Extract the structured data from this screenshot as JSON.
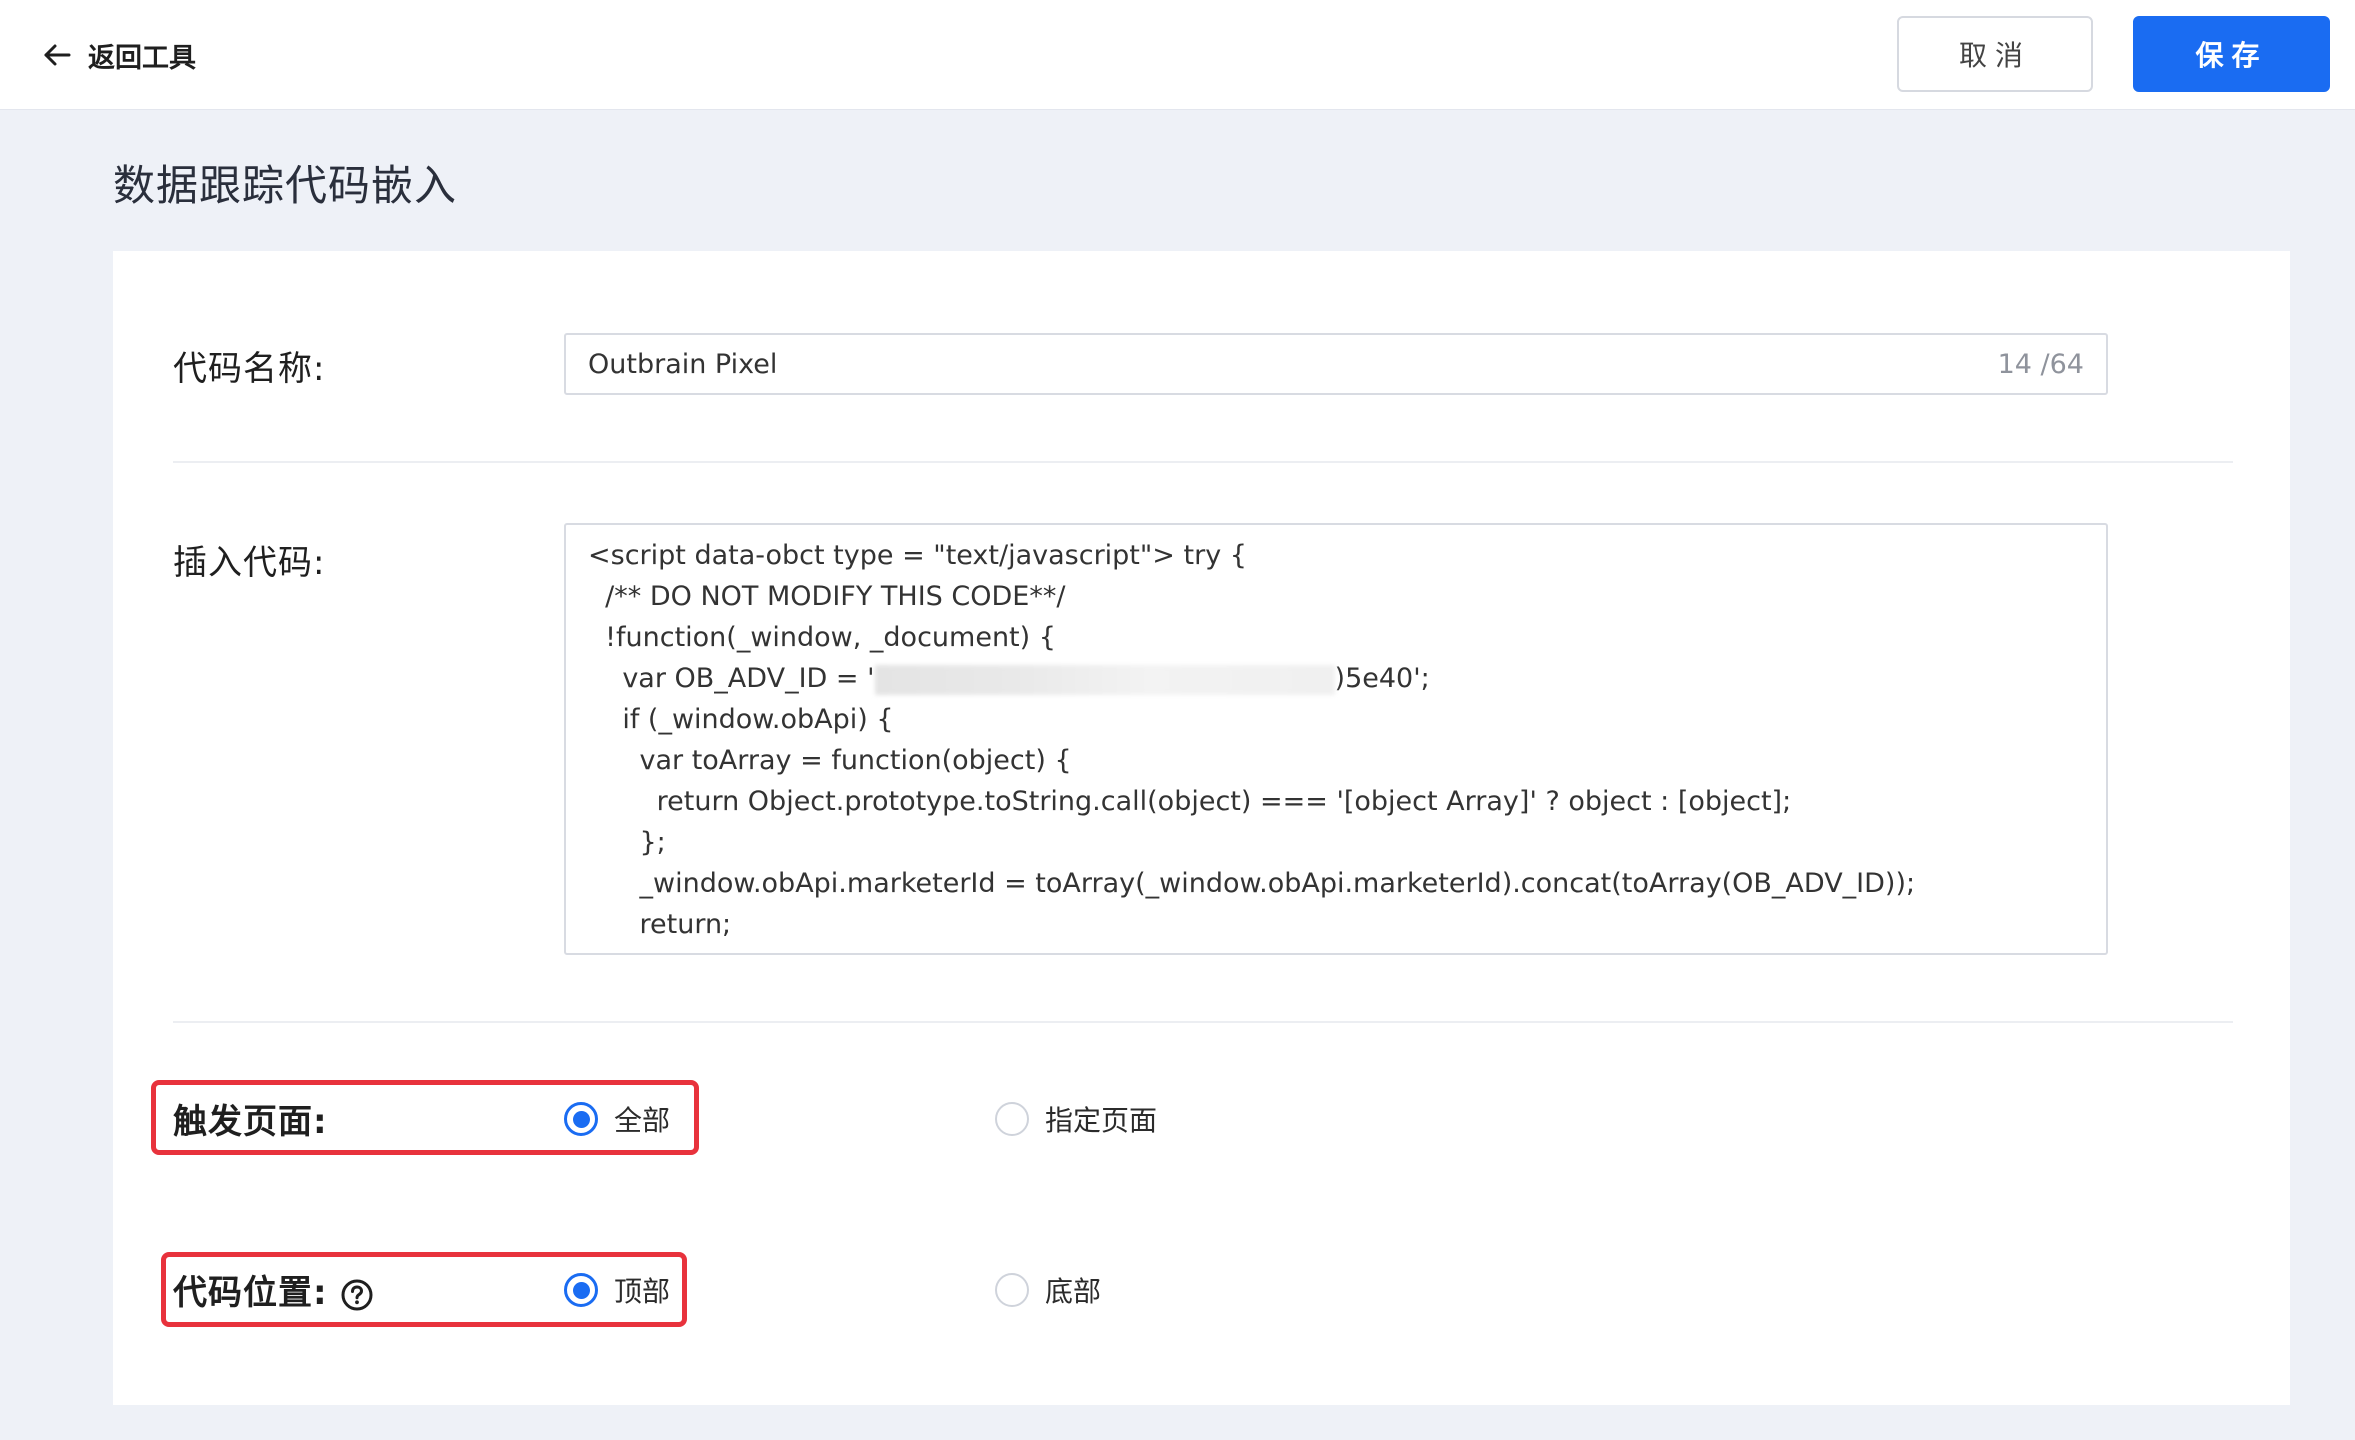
{
  "header": {
    "back_label": "返回工具",
    "cancel_label": "取消",
    "save_label": "保存"
  },
  "page": {
    "title": "数据跟踪代码嵌入"
  },
  "form": {
    "code_name": {
      "label": "代码名称:",
      "value": "Outbrain Pixel",
      "counter": "14 /64"
    },
    "insert_code": {
      "label": "插入代码:",
      "lines": [
        "<script data-obct type = \"text/javascript\"> try {",
        "  /** DO NOT MODIFY THIS CODE**/",
        "  !function(_window, _document) {",
        "    var OB_ADV_ID = '",
        "    if (_window.obApi) {",
        "      var toArray = function(object) {",
        "        return Object.prototype.toString.call(object) === '[object Array]' ? object : [object];",
        "      };",
        "      _window.obApi.marketerId = toArray(_window.obApi.marketerId).concat(toArray(OB_ADV_ID));",
        "      return;"
      ],
      "line4_suffix": ")5e40';"
    },
    "trigger_page": {
      "label": "触发页面:",
      "options": [
        "全部",
        "指定页面"
      ],
      "selected": "全部"
    },
    "code_position": {
      "label": "代码位置:",
      "options": [
        "顶部",
        "底部"
      ],
      "selected": "顶部"
    }
  },
  "colors": {
    "primary": "#1a6cf2",
    "highlight": "#e8323c",
    "background": "#eef1f7"
  },
  "icons": {
    "back": "arrow-left-icon",
    "help": "question-circle-icon"
  }
}
